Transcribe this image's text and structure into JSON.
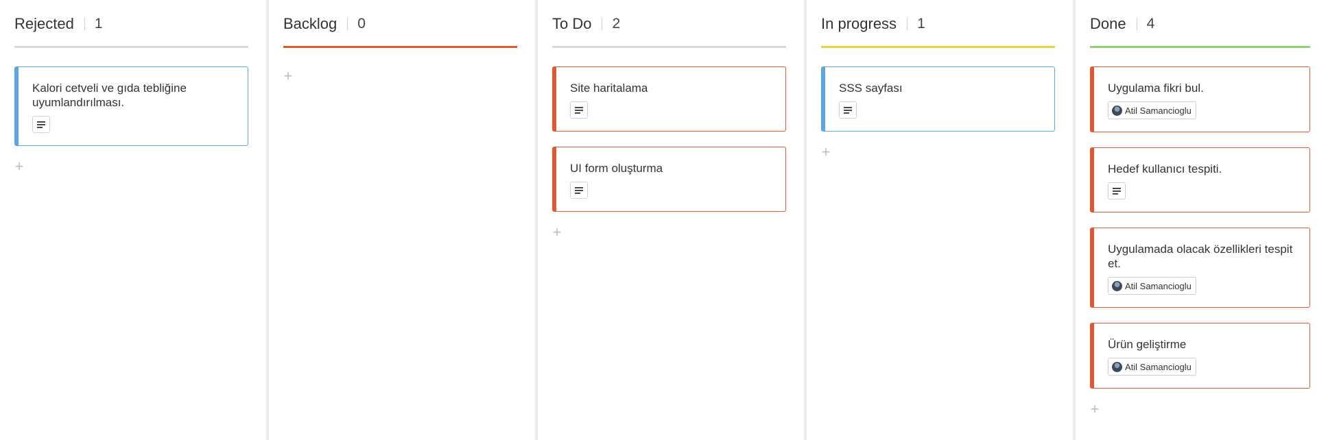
{
  "columns": [
    {
      "title": "Rejected",
      "count": "1",
      "accent": "#d9d9d9",
      "cards": [
        {
          "title": "Kalori cetveli ve gıda tebliğine uyumlandırılması.",
          "color": "#5aa6e6",
          "meta": "description",
          "meta_icon": "description-lines-icon"
        }
      ]
    },
    {
      "title": "Backlog",
      "count": "0",
      "accent": "#e4562f",
      "cards": []
    },
    {
      "title": "To Do",
      "count": "2",
      "accent": "#d9d9d9",
      "cards": [
        {
          "title": "Site haritalama",
          "color": "#e4562f",
          "meta": "description",
          "meta_icon": "description-lines-icon"
        },
        {
          "title": "UI form oluşturma",
          "color": "#e4562f",
          "meta": "description",
          "meta_icon": "description-lines-icon"
        }
      ]
    },
    {
      "title": "In progress",
      "count": "1",
      "accent": "#f2d23c",
      "cards": [
        {
          "title": "SSS sayfası",
          "color": "#5aa6e6",
          "meta": "description",
          "meta_icon": "description-lines-icon"
        }
      ]
    },
    {
      "title": "Done",
      "count": "4",
      "accent": "#8ed36a",
      "cards": [
        {
          "title": "Uygulama fikri bul.",
          "color": "#e4562f",
          "meta": "assignee",
          "assignee": "Atil Samancioglu"
        },
        {
          "title": "Hedef kullanıcı tespiti.",
          "color": "#e4562f",
          "meta": "description",
          "meta_icon": "description-lines-icon"
        },
        {
          "title": "Uygulamada olacak özellikleri tespit et.",
          "color": "#e4562f",
          "meta": "assignee",
          "assignee": "Atil Samancioglu"
        },
        {
          "title": "Ürün geliştirme",
          "color": "#e4562f",
          "meta": "assignee",
          "assignee": "Atil Samancioglu"
        }
      ]
    }
  ],
  "add_icon": "plus-icon",
  "add_glyph": "+"
}
